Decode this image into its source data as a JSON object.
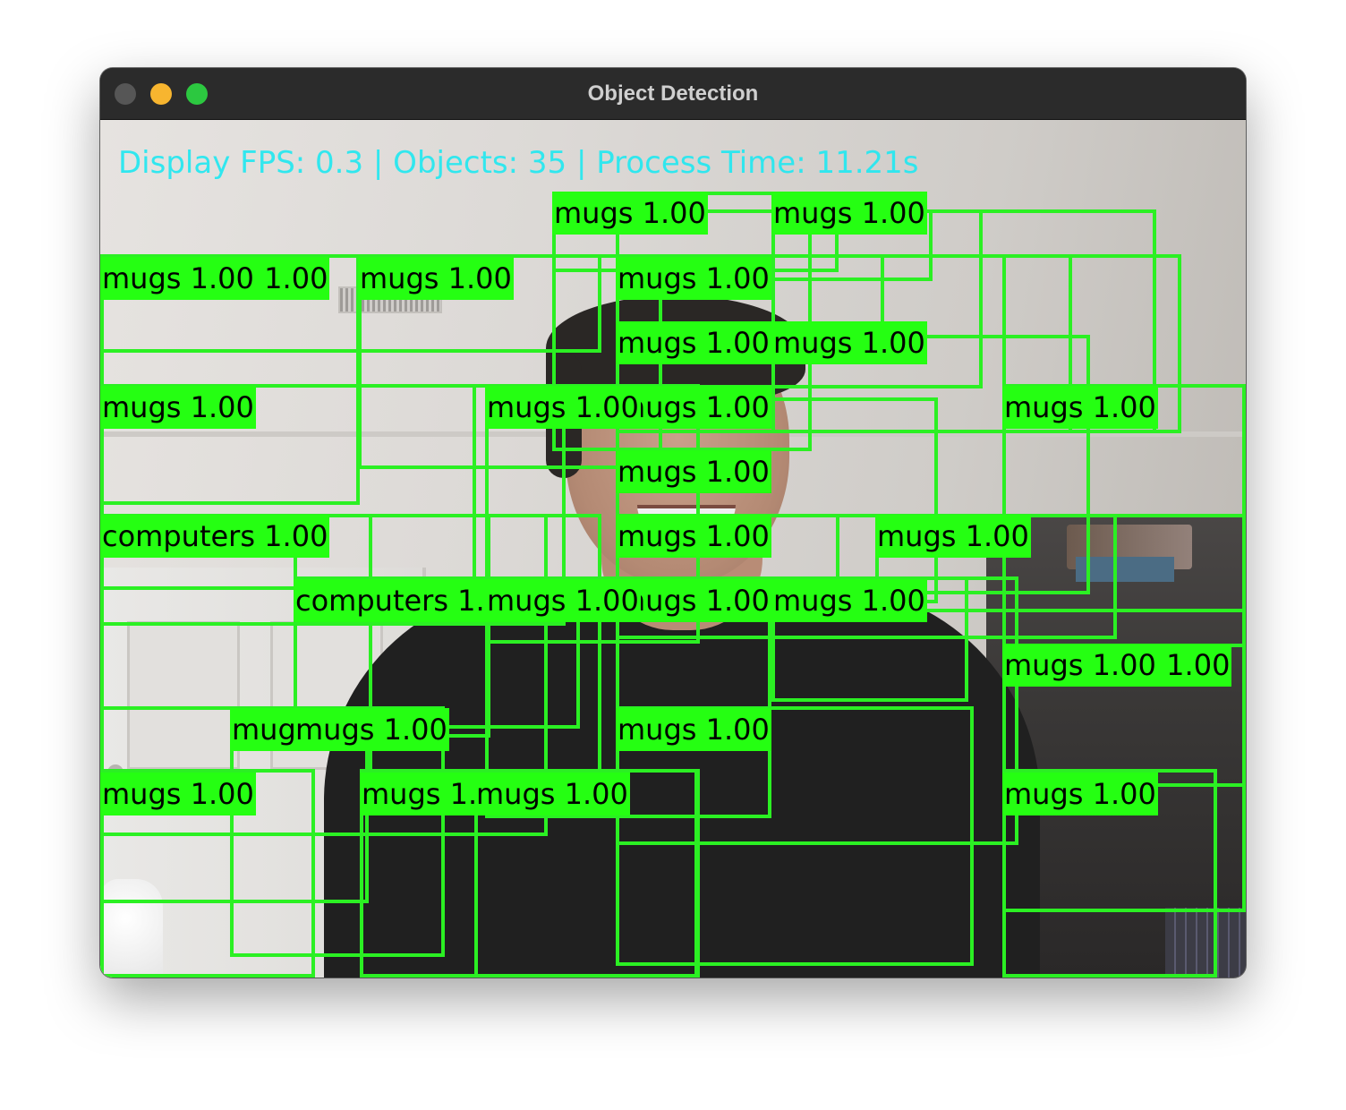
{
  "window": {
    "title": "Object Detection",
    "controls": [
      "close-button",
      "minimize-button",
      "zoom-button"
    ]
  },
  "hud": {
    "text": "Display FPS: 0.3 | Objects: 35 | Process Time: 11.21s",
    "color": "#28e8f0"
  },
  "box_color": "#2bf023",
  "label_bg_color": "#25ff12",
  "labels": [
    "computers 1.00",
    "mugs 1.00",
    "mugs 1.00",
    "mugs 1.00",
    "mugs 1.00",
    "mugs 1.00",
    "computers 1.00",
    "mugs 1.00",
    "mugs 1.00",
    "computers 1.00",
    "mugs 1.00",
    "mugs 1.00",
    "computers 1.00",
    "mugs 1.00",
    "mugs 1.00",
    "computers 1.00",
    "computers 1.00",
    "mugs 1.00",
    "mugs 1.00",
    "mugs 1.00",
    "mugs 1.00",
    "mugs 1.00",
    "mugs 1.00",
    "mugs 1.00",
    "mugs 1.00",
    "mugs 1.00",
    "mugs 1.00",
    "mugs 1.00",
    "mugs 1.00",
    "mugs 1.00",
    "mugs 1.00",
    "mugs 1.00",
    "mugs 1.00",
    "mugs 1.00",
    "mugs 1.00"
  ]
}
